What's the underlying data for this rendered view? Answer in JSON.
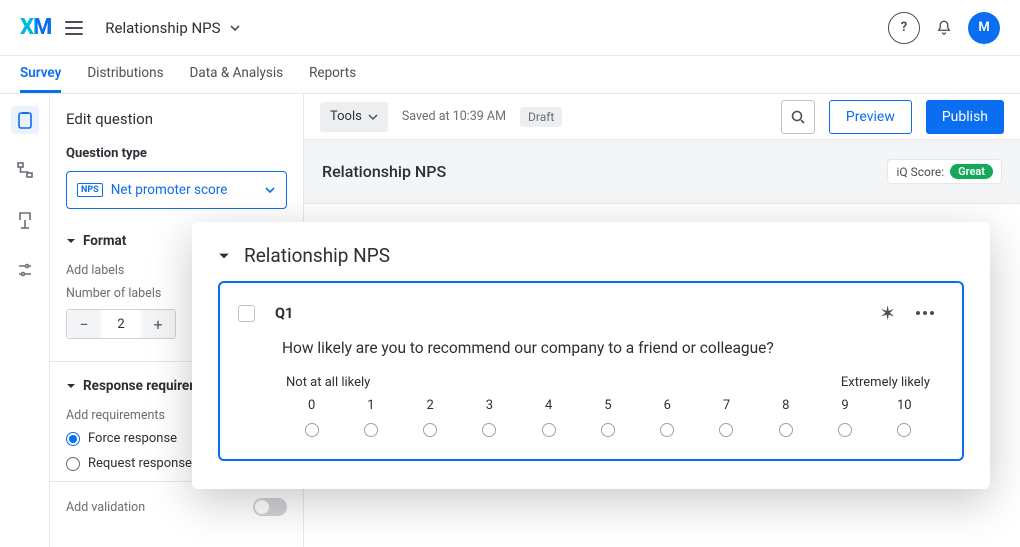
{
  "topbar": {
    "logo": "XM",
    "project_name": "Relationship NPS",
    "help_label": "?",
    "avatar_initial": "M"
  },
  "tabs": {
    "items": [
      {
        "label": "Survey",
        "active": true
      },
      {
        "label": "Distributions",
        "active": false
      },
      {
        "label": "Data & Analysis",
        "active": false
      },
      {
        "label": "Reports",
        "active": false
      }
    ]
  },
  "edit": {
    "title": "Edit question",
    "question_type_label": "Question type",
    "question_type_badge": "NPS",
    "question_type_value": "Net promoter score",
    "format_section": "Format",
    "add_labels": "Add labels",
    "num_labels_label": "Number of labels",
    "num_labels_value": "2",
    "response_req_section": "Response requirements",
    "add_requirements": "Add requirements",
    "force_response": "Force response",
    "request_response": "Request response",
    "add_validation": "Add validation"
  },
  "canvas": {
    "tools_label": "Tools",
    "saved_at": "Saved at 10:39 AM",
    "draft_pill": "Draft",
    "preview_label": "Preview",
    "publish_label": "Publish",
    "survey_title": "Relationship NPS",
    "iq_score_label": "iQ Score:",
    "iq_score_value": "Great"
  },
  "overlay": {
    "block_title": "Relationship NPS",
    "q_number": "Q1",
    "q_text": "How likely are you to recommend our company to a friend or colleague?",
    "low_label": "Not at all likely",
    "high_label": "Extremely likely",
    "scale": [
      "0",
      "1",
      "2",
      "3",
      "4",
      "5",
      "6",
      "7",
      "8",
      "9",
      "10"
    ]
  }
}
